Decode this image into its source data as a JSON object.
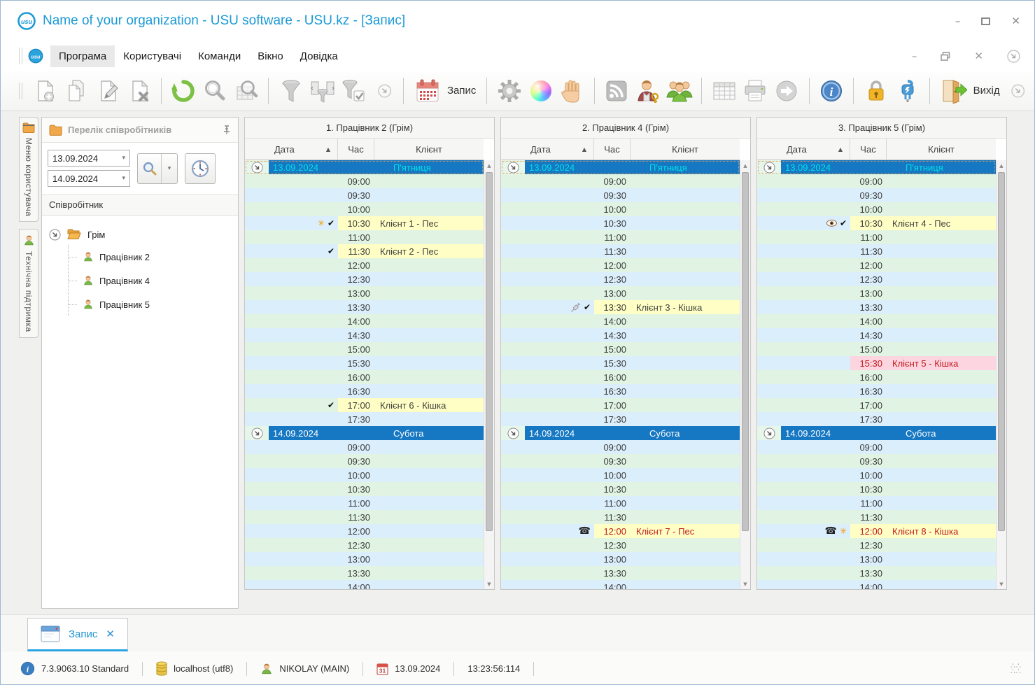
{
  "window": {
    "title": "Name of your organization - USU software - USU.kz - [Запис]",
    "controls": [
      "minimize",
      "maximize",
      "close"
    ]
  },
  "menu": {
    "items": [
      "Програма",
      "Користувачі",
      "Команди",
      "Вікно",
      "Довідка"
    ],
    "active_item": "Програма",
    "controls": [
      "minimize",
      "restore",
      "close",
      "chevron"
    ]
  },
  "toolbar": {
    "record_label": "Запис",
    "exit_label": "Вихід",
    "icons": [
      "add-record",
      "copy-record",
      "edit-record",
      "delete-record",
      "refresh",
      "search",
      "search-table",
      "filter",
      "filter-columns",
      "filter-apply",
      "chevron-more",
      "calendar-record",
      "settings-gear",
      "color-theme",
      "hand-pan",
      "rss-feed",
      "user-key",
      "users-group",
      "table-grid",
      "printer",
      "export-arrow",
      "info",
      "lock",
      "plug-connection",
      "exit-door",
      "chevron-more"
    ]
  },
  "side_tabs": [
    {
      "label": "Меню користувача",
      "icon": "folder-icon"
    },
    {
      "label": "Технічна підтримка",
      "icon": "person-icon"
    }
  ],
  "sidebar": {
    "title": "Перелік співробітників",
    "date_from": "13.09.2024",
    "date_to": "14.09.2024",
    "tree_header": "Співробітник",
    "group": "Грім",
    "employees": [
      "Працівник 2",
      "Працівник 4",
      "Працівник 5"
    ]
  },
  "schedule": {
    "col_headers": {
      "date": "Дата",
      "time": "Час",
      "client": "Клієнт"
    },
    "day1_times": [
      "09:00",
      "09:30",
      "10:00",
      "10:30",
      "11:00",
      "11:30",
      "12:00",
      "12:30",
      "13:00",
      "13:30",
      "14:00",
      "14:30",
      "15:00",
      "15:30",
      "16:00",
      "16:30",
      "17:00",
      "17:30"
    ],
    "day2_times": [
      "09:00",
      "09:30",
      "10:00",
      "10:30",
      "11:00",
      "11:30",
      "12:00",
      "12:30",
      "13:00",
      "13:30",
      "14:00"
    ],
    "columns": [
      {
        "title": "1. Працівник 2 (Грім)",
        "days": [
          {
            "date": "13.09.2024",
            "weekday": "П'ятниця",
            "selected": true,
            "appointments": [
              {
                "time": "10:30",
                "client": "Клієнт 1 - Пес",
                "icons": [
                  "asterisk",
                  "check"
                ],
                "highlight": "yellow",
                "text": "dark"
              },
              {
                "time": "11:30",
                "client": "Клієнт 2 - Пес",
                "icons": [
                  "check"
                ],
                "highlight": "yellow",
                "text": "dark"
              },
              {
                "time": "17:00",
                "client": "Клієнт 6 - Кішка",
                "icons": [
                  "check"
                ],
                "highlight": "yellow",
                "text": "dark"
              }
            ]
          },
          {
            "date": "14.09.2024",
            "weekday": "Субота",
            "selected": false,
            "appointments": []
          }
        ]
      },
      {
        "title": "2. Працівник 4 (Грім)",
        "days": [
          {
            "date": "13.09.2024",
            "weekday": "П'ятниця",
            "selected": true,
            "appointments": [
              {
                "time": "13:30",
                "client": "Клієнт 3 - Кішка",
                "icons": [
                  "syringe",
                  "check"
                ],
                "highlight": "yellow",
                "text": "dark"
              }
            ]
          },
          {
            "date": "14.09.2024",
            "weekday": "Субота",
            "selected": false,
            "appointments": [
              {
                "time": "12:00",
                "client": "Клієнт 7 - Пес",
                "icons": [
                  "phone"
                ],
                "highlight": "yellow",
                "text": "red"
              }
            ]
          }
        ]
      },
      {
        "title": "3. Працівник 5 (Грім)",
        "days": [
          {
            "date": "13.09.2024",
            "weekday": "П'ятниця",
            "selected": true,
            "appointments": [
              {
                "time": "10:30",
                "client": "Клієнт 4 - Пес",
                "icons": [
                  "eye",
                  "check"
                ],
                "highlight": "yellow",
                "text": "dark"
              },
              {
                "time": "15:30",
                "client": "Клієнт 5 - Кішка",
                "icons": [],
                "highlight": "pink",
                "text": "red"
              }
            ]
          },
          {
            "date": "14.09.2024",
            "weekday": "Субота",
            "selected": false,
            "appointments": [
              {
                "time": "12:00",
                "client": "Клієнт 8 - Кішка",
                "icons": [
                  "phone",
                  "asterisk"
                ],
                "highlight": "yellow",
                "text": "red"
              }
            ]
          }
        ]
      }
    ]
  },
  "bottom_tab": {
    "label": "Запис"
  },
  "status_bar": {
    "version": "7.3.9063.10 Standard",
    "database": "localhost (utf8)",
    "user": "NIKOLAY (MAIN)",
    "date": "13.09.2024",
    "time": "13:23:56:114"
  },
  "glyphs": {
    "sort_asc": "▲",
    "check": "✔",
    "asterisk": "✳",
    "phone": "☎",
    "scroll_up": "▲",
    "scroll_down": "▼",
    "caret_down": "▾",
    "minimize": "–",
    "close": "✕"
  },
  "colors": {
    "accent_blue": "#1b9ad6",
    "date_row_blue": "#1677c2",
    "selected_text_cyan": "#00e0e6",
    "row_green": "#e1f4e3",
    "row_blue": "#dbeefb",
    "appointment_yellow": "#ffffc5",
    "appointment_pink": "#fcd5e0",
    "alert_red": "#c11b1b",
    "tab_underline": "#29a3e3"
  }
}
